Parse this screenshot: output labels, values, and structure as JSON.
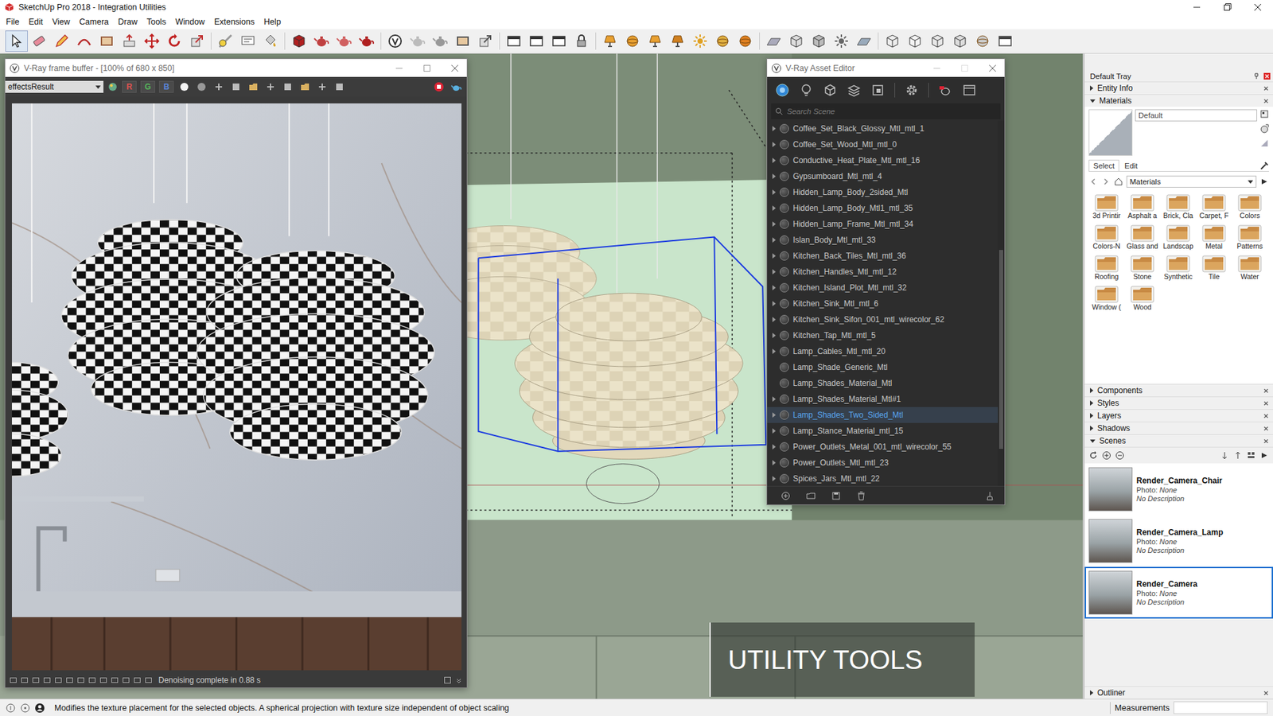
{
  "app": {
    "title": "SketchUp Pro 2018 - Integration Utilities"
  },
  "menu": [
    "File",
    "Edit",
    "View",
    "Camera",
    "Draw",
    "Tools",
    "Window",
    "Extensions",
    "Help"
  ],
  "frame_buffer": {
    "title": "V-Ray frame buffer - [100% of 680 x 850]",
    "channel": "effectsResult",
    "color_channels": [
      {
        "label": "R",
        "selected": false,
        "color": "#e0524f"
      },
      {
        "label": "G",
        "selected": false,
        "color": "#55b85a"
      },
      {
        "label": "B",
        "selected": false,
        "color": "#5a86d8"
      }
    ],
    "status": "Denoising complete in 0.88 s"
  },
  "asset_editor": {
    "title": "V-Ray Asset Editor",
    "search": {
      "placeholder": "Search Scene"
    },
    "materials": [
      {
        "name": "Coffee_Set_Black_Glossy_Mtl_mtl_1",
        "expandable": true,
        "selected": false
      },
      {
        "name": "Coffee_Set_Wood_Mtl_mtl_0",
        "expandable": true,
        "selected": false
      },
      {
        "name": "Conductive_Heat_Plate_Mtl_mtl_16",
        "expandable": true,
        "selected": false
      },
      {
        "name": "Gypsumboard_Mtl_mtl_4",
        "expandable": true,
        "selected": false
      },
      {
        "name": "Hidden_Lamp_Body_2sided_Mtl",
        "expandable": true,
        "selected": false
      },
      {
        "name": "Hidden_Lamp_Body_Mtl1_mtl_35",
        "expandable": true,
        "selected": false
      },
      {
        "name": "Hidden_Lamp_Frame_Mtl_mtl_34",
        "expandable": true,
        "selected": false
      },
      {
        "name": "Islan_Body_Mtl_mtl_33",
        "expandable": true,
        "selected": false
      },
      {
        "name": "Kitchen_Back_Tiles_Mtl_mtl_36",
        "expandable": true,
        "selected": false
      },
      {
        "name": "Kitchen_Handles_Mtl_mtl_12",
        "expandable": true,
        "selected": false
      },
      {
        "name": "Kitchen_Island_Plot_Mtl_mtl_32",
        "expandable": true,
        "selected": false
      },
      {
        "name": "Kitchen_Sink_Mtl_mtl_6",
        "expandable": true,
        "selected": false
      },
      {
        "name": "Kitchen_Sink_Sifon_001_mtl_wirecolor_62",
        "expandable": true,
        "selected": false
      },
      {
        "name": "Kitchen_Tap_Mtl_mtl_5",
        "expandable": true,
        "selected": false
      },
      {
        "name": "Lamp_Cables_Mtl_mtl_20",
        "expandable": true,
        "selected": false
      },
      {
        "name": "Lamp_Shade_Generic_Mtl",
        "expandable": false,
        "selected": false
      },
      {
        "name": "Lamp_Shades_Material_Mtl",
        "expandable": false,
        "selected": false
      },
      {
        "name": "Lamp_Shades_Material_Mtl#1",
        "expandable": true,
        "selected": false
      },
      {
        "name": "Lamp_Shades_Two_Sided_Mtl",
        "expandable": true,
        "selected": true
      },
      {
        "name": "Lamp_Stance_Material_mtl_15",
        "expandable": true,
        "selected": false
      },
      {
        "name": "Power_Outlets_Metal_001_mtl_wirecolor_55",
        "expandable": true,
        "selected": false
      },
      {
        "name": "Power_Outlets_Mtl_mtl_23",
        "expandable": true,
        "selected": false
      },
      {
        "name": "Spices_Jars_Mtl_mtl_22",
        "expandable": true,
        "selected": false
      }
    ]
  },
  "viewport": {
    "caption": "UTILITY TOOLS"
  },
  "tray": {
    "title": "Default Tray",
    "top_sections": [
      {
        "label": "Entity Info",
        "expanded": false
      },
      {
        "label": "Materials",
        "expanded": true
      }
    ],
    "materials": {
      "name": "Default",
      "tabs": [
        {
          "label": "Select",
          "selected": true
        },
        {
          "label": "Edit",
          "selected": false
        }
      ],
      "library": "Materials",
      "folders": [
        "3d Printir",
        "Asphalt a",
        "Brick, Cla",
        "Carpet, F",
        "Colors",
        "Colors-N",
        "Glass and",
        "Landscap",
        "Metal",
        "Patterns",
        "Roofing",
        "Stone",
        "Synthetic",
        "Tile",
        "Water",
        "Window (",
        "Wood"
      ]
    },
    "mid_sections": [
      {
        "label": "Components",
        "expanded": false
      },
      {
        "label": "Styles",
        "expanded": false
      },
      {
        "label": "Layers",
        "expanded": false
      },
      {
        "label": "Shadows",
        "expanded": false
      },
      {
        "label": "Scenes",
        "expanded": true
      }
    ],
    "scenes": [
      {
        "name": "Render_Camera_Chair",
        "photo_label": "Photo:",
        "photo": "None",
        "description": "No Description",
        "selected": false
      },
      {
        "name": "Render_Camera_Lamp",
        "photo_label": "Photo:",
        "photo": "None",
        "description": "No Description",
        "selected": false
      },
      {
        "name": "Render_Camera",
        "photo_label": "Photo:",
        "photo": "None",
        "description": "No Description",
        "selected": true
      }
    ],
    "bottom_sections": [
      {
        "label": "Outliner",
        "expanded": false
      }
    ]
  },
  "status_bar": {
    "hint": "Modifies the texture placement for the selected objects. A spherical projection with texture size independent of object scaling",
    "measurements": "Measurements"
  }
}
